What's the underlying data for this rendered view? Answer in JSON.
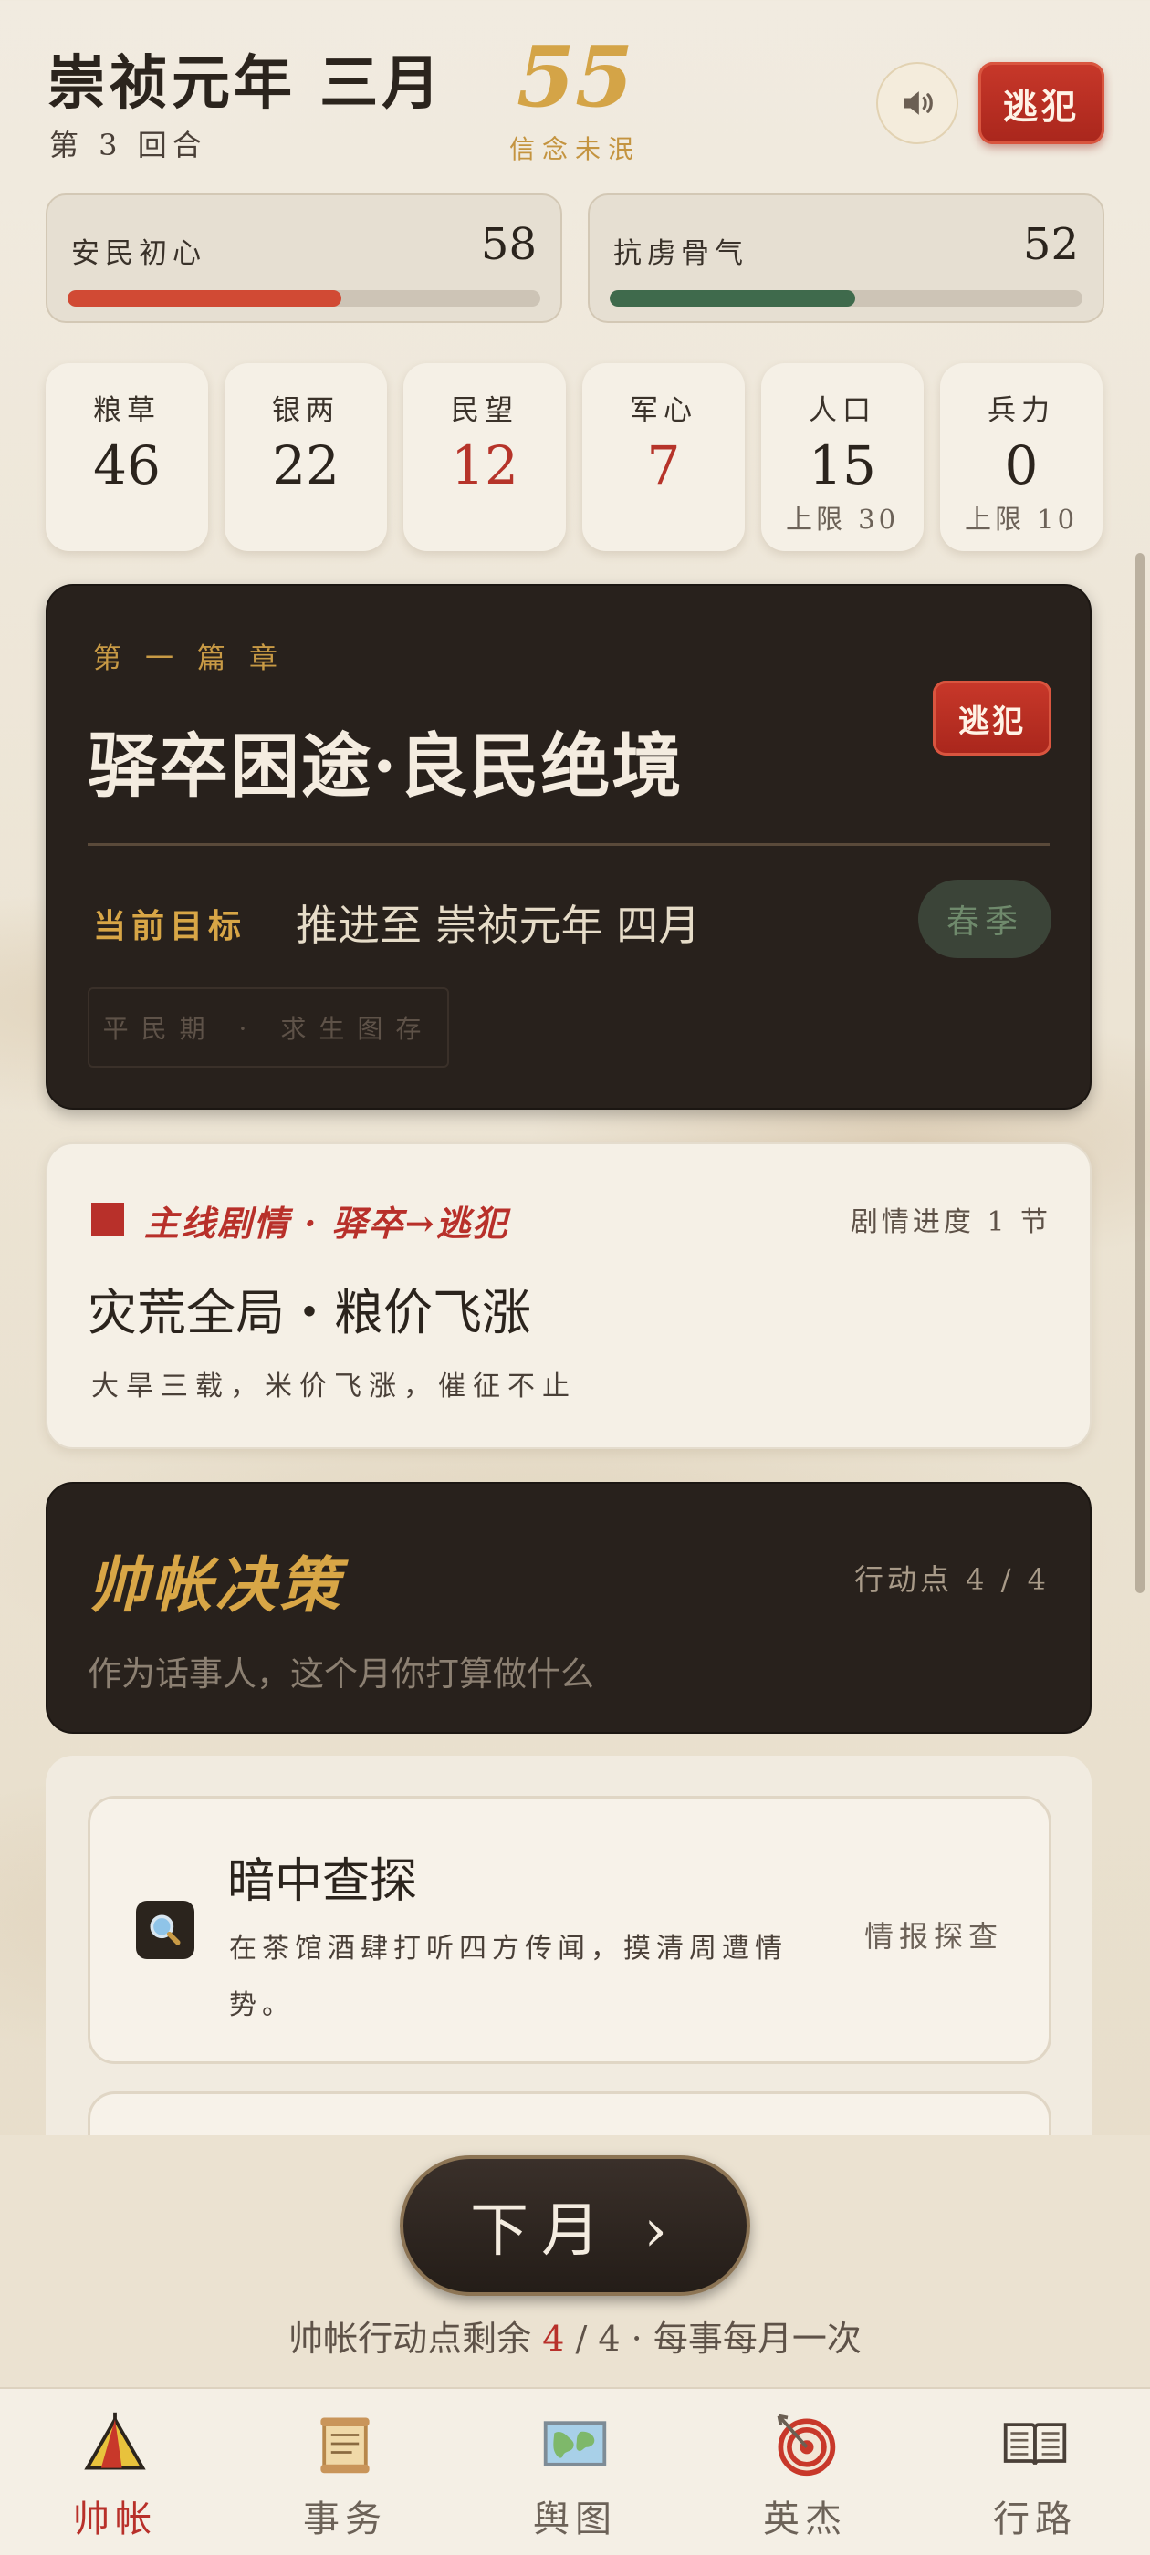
{
  "header": {
    "era_title": "崇祯元年 三月",
    "round_label": "第 3 回合",
    "faith_number": "55",
    "faith_label": "信念未泯",
    "flee_button": "逃犯"
  },
  "meters": [
    {
      "label": "安民初心",
      "value": "58",
      "percent": 58,
      "color": "#d14a34"
    },
    {
      "label": "抗虏骨气",
      "value": "52",
      "percent": 52,
      "color": "#3f6a4c"
    }
  ],
  "resources": [
    {
      "label": "粮草",
      "value": "46",
      "sub": ""
    },
    {
      "label": "银两",
      "value": "22",
      "sub": ""
    },
    {
      "label": "民望",
      "value": "12",
      "sub": ""
    },
    {
      "label": "军心",
      "value": "7",
      "sub": ""
    },
    {
      "label": "人口",
      "value": "15",
      "sub": "上限 30"
    },
    {
      "label": "兵力",
      "value": "0",
      "sub": "上限 10"
    }
  ],
  "chapter": {
    "number": "第一篇章",
    "title": "驿卒困途·良民绝境",
    "flee_badge": "逃犯",
    "goal_label": "当前目标",
    "goal": "推进至 崇祯元年 四月",
    "season": "春季",
    "period": "平民期 · 求生图存"
  },
  "story": {
    "label": "主线剧情 · 驿卒→逃犯",
    "progress": "剧情进度 1 节",
    "title": "灾荒全局・粮价飞涨",
    "desc": "大旱三载，米价飞涨，催征不止"
  },
  "decision": {
    "title": "帅帐决策",
    "points": "行动点 4 / 4",
    "subtitle": "作为话事人，这个月你打算做什么"
  },
  "actions": [
    {
      "icon": "magnifier-icon",
      "title": "暗中查探",
      "desc": "在茶馆酒肆打听四方传闻，摸清周遭情势。",
      "tag": "情报探查"
    }
  ],
  "next": {
    "button": "下月 ›",
    "hint_prefix": "帅帐行动点剩余 ",
    "hint_remaining": "4",
    "hint_suffix": " / 4 · 每事每月一次"
  },
  "tabs": [
    {
      "label": "帅帐",
      "icon": "tent-icon",
      "active": true
    },
    {
      "label": "事务",
      "icon": "scroll-icon",
      "active": false
    },
    {
      "label": "舆图",
      "icon": "map-icon",
      "active": false
    },
    {
      "label": "英杰",
      "icon": "target-icon",
      "active": false
    },
    {
      "label": "行路",
      "icon": "book-icon",
      "active": false
    }
  ]
}
